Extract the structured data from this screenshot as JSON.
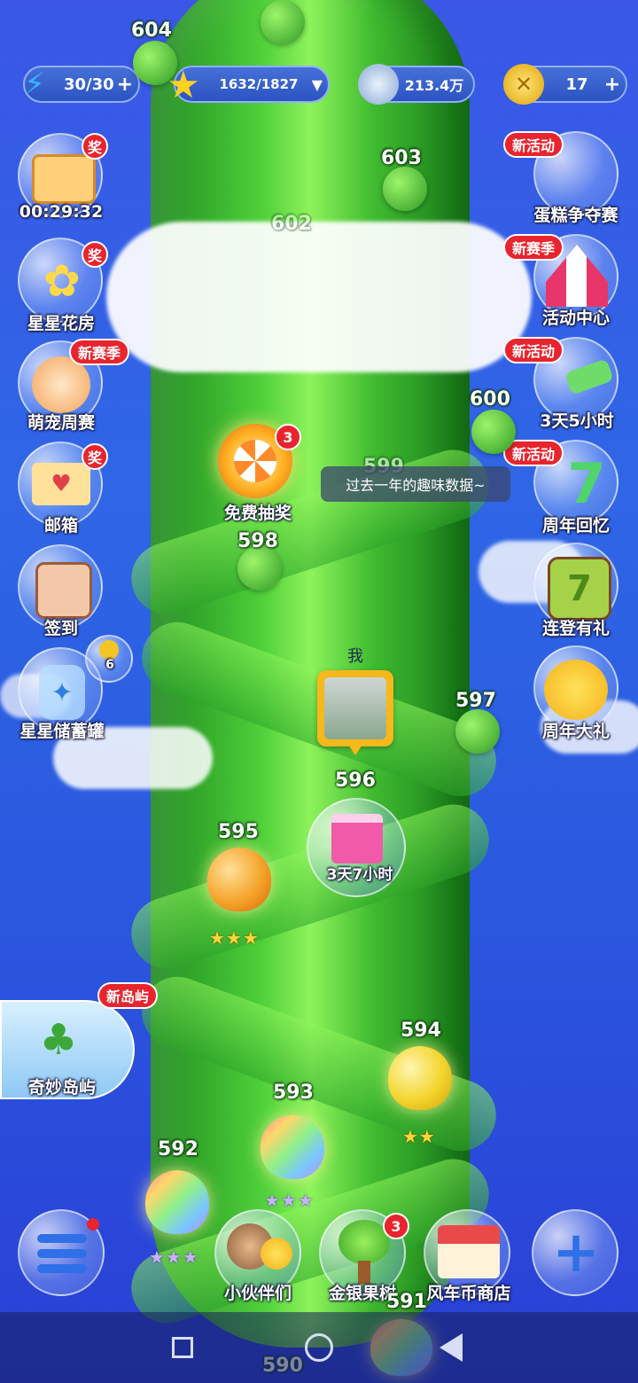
{
  "resources": {
    "energy": {
      "value": "30/30",
      "plus": "+"
    },
    "stars": {
      "value": "1632/1827",
      "dropdown": "▼"
    },
    "coins": {
      "value": "213.4万"
    },
    "windmill_coins": {
      "value": "17",
      "plus": "+"
    }
  },
  "left_menu": [
    {
      "label": "00:29:32",
      "badge": "奖",
      "icon": "id-card-icon"
    },
    {
      "label": "星星花房",
      "badge": "奖",
      "icon": "flower-pot-icon"
    },
    {
      "label": "萌宠周赛",
      "badge": "新赛季",
      "icon": "cat-icon"
    },
    {
      "label": "邮箱",
      "badge": "奖",
      "icon": "envelope-icon"
    },
    {
      "label": "签到",
      "icon": "calendar-icon"
    },
    {
      "label": "星星储蓄罐",
      "badge": "6",
      "icon": "piggy-jar-icon"
    }
  ],
  "right_menu": [
    {
      "label": "蛋糕争夺赛",
      "badge": "新活动"
    },
    {
      "label": "活动中心",
      "badge": "新赛季"
    },
    {
      "label": "3天5小时",
      "badge": "新活动"
    },
    {
      "label": "周年回忆",
      "badge": "新活动"
    },
    {
      "label": "连登有礼"
    },
    {
      "label": "周年大礼"
    }
  ],
  "lottery": {
    "label": "免费抽奖",
    "badge": "3"
  },
  "tooltip": "过去一年的趣味数据~",
  "player": {
    "label": "我"
  },
  "gift": {
    "label": "3天7小时"
  },
  "island": {
    "label": "奇妙岛屿",
    "badge": "新岛屿"
  },
  "levels": [
    "604",
    "603",
    "602",
    "600",
    "599",
    "598",
    "597",
    "596",
    "595",
    "594",
    "593",
    "592",
    "591",
    "590"
  ],
  "bottom_bar": {
    "friends": "小伙伴们",
    "tree": "金银果树",
    "tree_badge": "3",
    "shop": "风车币商店"
  },
  "stars_595": "★★★",
  "stars_594": "★★",
  "stars_593": "★★★",
  "stars_592": "★★★"
}
